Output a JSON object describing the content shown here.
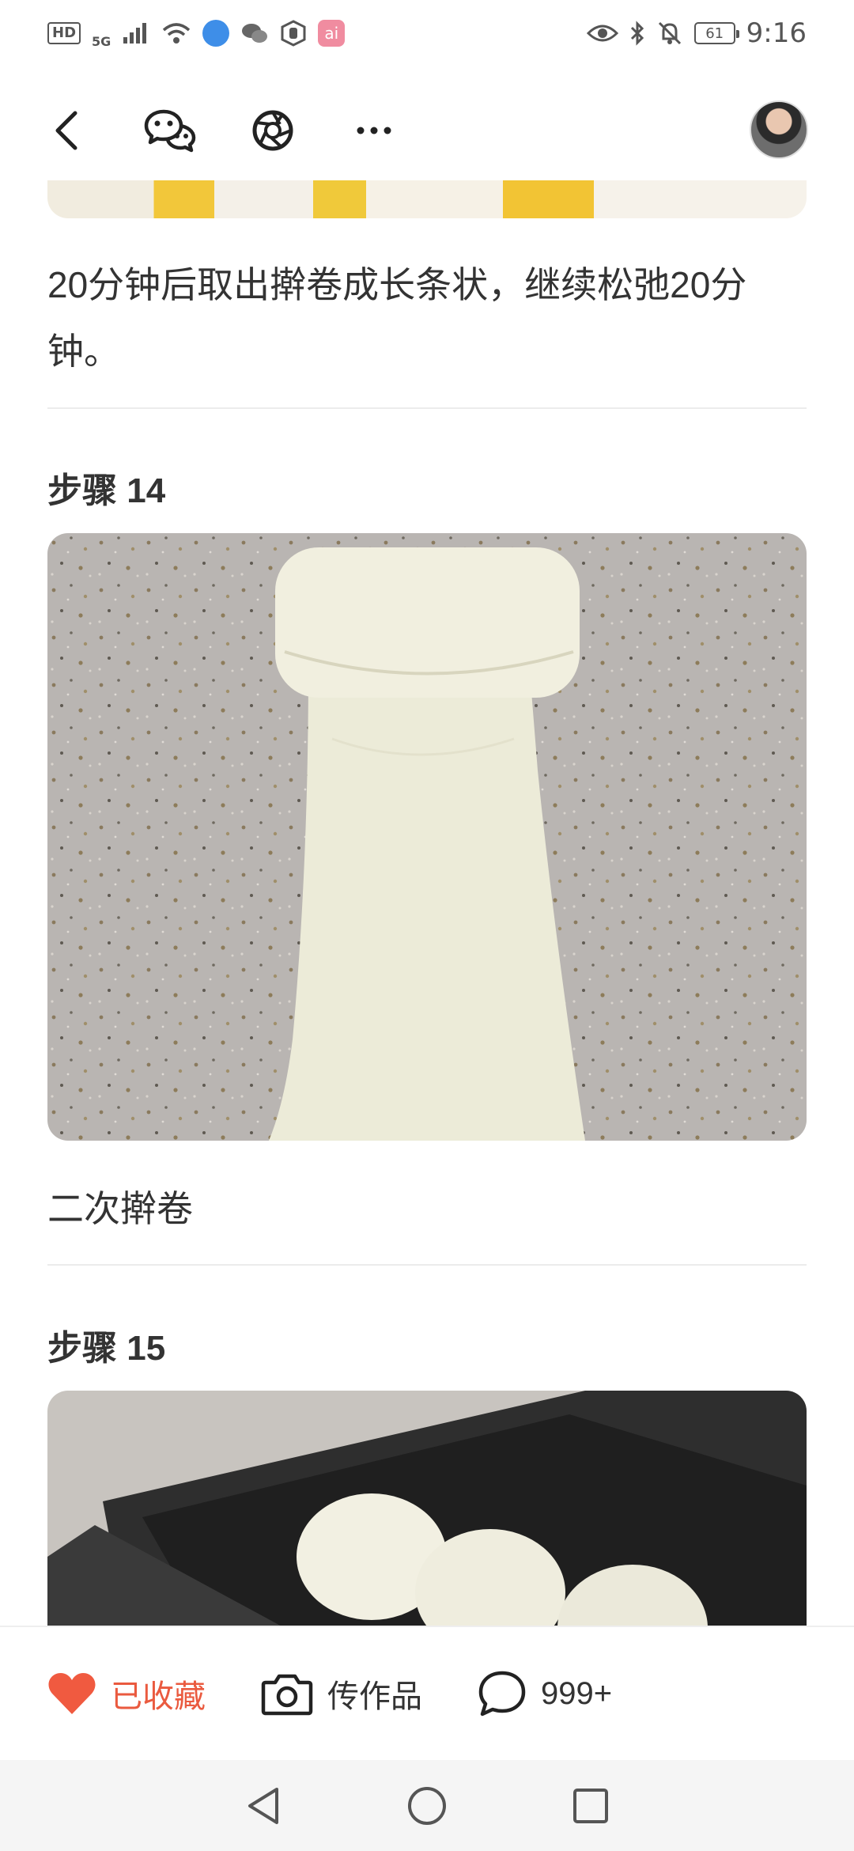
{
  "status_bar": {
    "left_badge": "HD",
    "network": "5G",
    "app_badge": "ai",
    "battery": "61",
    "time": "9:16"
  },
  "toolbar": {
    "icons": [
      "back-icon",
      "wechat-icon",
      "moments-icon",
      "more-icon"
    ],
    "more_label": "···"
  },
  "steps": [
    {
      "description": "20分钟后取出擀卷成长条状，继续松弛20分钟。"
    },
    {
      "title": "步骤 14",
      "description": "二次擀卷"
    },
    {
      "title": "步骤 15"
    }
  ],
  "actions": {
    "favorite_label": "已收藏",
    "upload_label": "传作品",
    "comments_count": "999+"
  },
  "colors": {
    "accent": "#ea5a3f",
    "text": "#333333",
    "divider": "#ececec"
  }
}
